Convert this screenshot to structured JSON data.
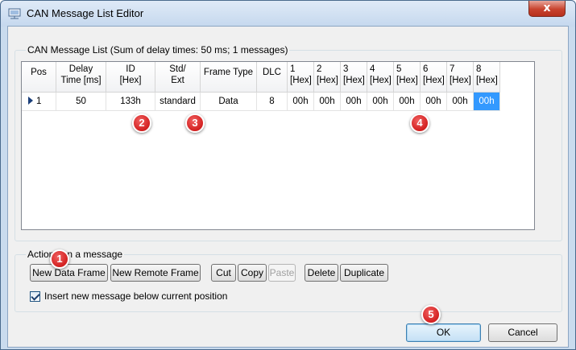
{
  "window": {
    "title": "CAN Message List Editor",
    "close_glyph": "x"
  },
  "message_list": {
    "group_title": "CAN Message List (Sum of delay times: 50 ms; 1 messages)",
    "columns": [
      {
        "line1": "Pos",
        "line2": ""
      },
      {
        "line1": "Delay",
        "line2": "Time [ms]"
      },
      {
        "line1": "ID",
        "line2": "[Hex]"
      },
      {
        "line1": "Std/",
        "line2": "Ext"
      },
      {
        "line1": "Frame Type",
        "line2": ""
      },
      {
        "line1": "DLC",
        "line2": ""
      },
      {
        "line1": "1",
        "line2": "[Hex]"
      },
      {
        "line1": "2",
        "line2": "[Hex]"
      },
      {
        "line1": "3",
        "line2": "[Hex]"
      },
      {
        "line1": "4",
        "line2": "[Hex]"
      },
      {
        "line1": "5",
        "line2": "[Hex]"
      },
      {
        "line1": "6",
        "line2": "[Hex]"
      },
      {
        "line1": "7",
        "line2": "[Hex]"
      },
      {
        "line1": "8",
        "line2": "[Hex]"
      }
    ],
    "rows": [
      [
        "1",
        "50",
        "133h",
        "standard",
        "Data",
        "8",
        "00h",
        "00h",
        "00h",
        "00h",
        "00h",
        "00h",
        "00h",
        "00h"
      ]
    ],
    "selected_cell": {
      "row": 0,
      "column": 13
    }
  },
  "actions": {
    "group_title": "Actions on a message",
    "new_data_frame": "New Data Frame",
    "new_remote_frame": "New Remote Frame",
    "cut": "Cut",
    "copy": "Copy",
    "paste": "Paste",
    "delete": "Delete",
    "duplicate": "Duplicate",
    "insert_below_label": "Insert new message below current position",
    "insert_below_checked": true
  },
  "footer": {
    "ok": "OK",
    "cancel": "Cancel"
  },
  "callouts": [
    "1",
    "2",
    "3",
    "4",
    "5"
  ],
  "colors": {
    "selection": "#3399ff",
    "callout": "#d32020",
    "close_button": "#c8432e"
  }
}
